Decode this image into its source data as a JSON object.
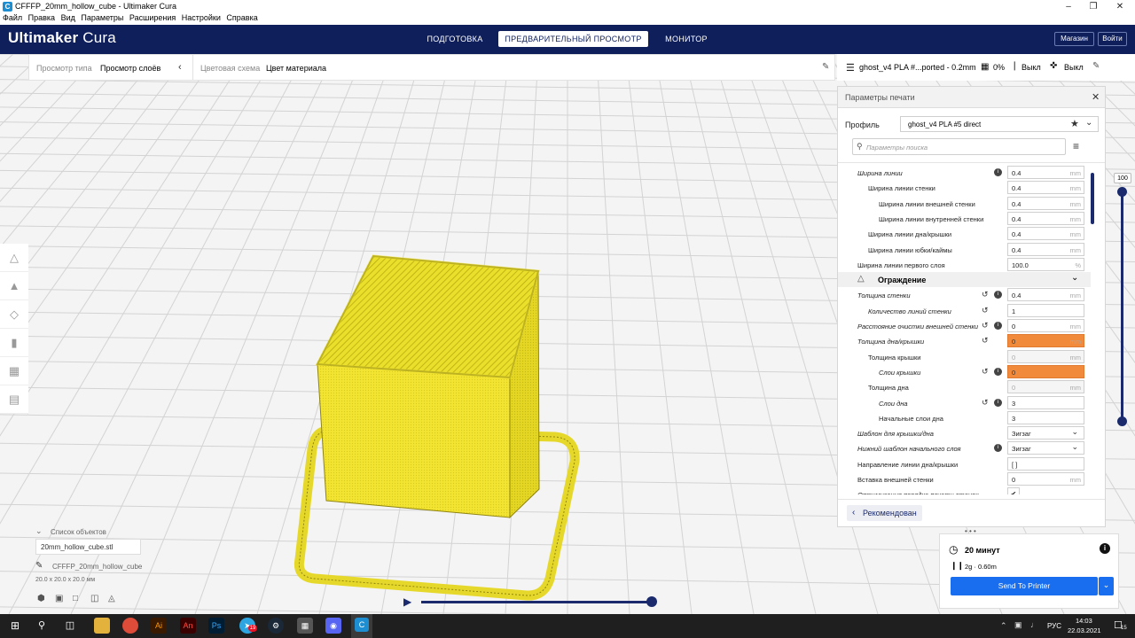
{
  "window": {
    "title": "CFFFP_20mm_hollow_cube - Ultimaker Cura"
  },
  "menu": [
    "Файл",
    "Правка",
    "Вид",
    "Параметры",
    "Расширения",
    "Настройки",
    "Справка"
  ],
  "header": {
    "logo_bold": "Ultimaker",
    "logo_light": "Cura",
    "stages": {
      "prepare": "ПОДГОТОВКА",
      "preview": "ПРЕДВАРИТЕЛЬНЫЙ ПРОСМОТР",
      "monitor": "МОНИТОР"
    },
    "marketplace": "Магазин",
    "signin": "Войти"
  },
  "viewbar": {
    "view_type_label": "Просмотр типа",
    "view_type_value": "Просмотр слоёв",
    "color_scheme_label": "Цветовая схема",
    "color_scheme_value": "Цвет материала"
  },
  "print_setup": {
    "profile_summary": "ghost_v4 PLA #...ported - 0.2mm",
    "infill": "0%",
    "support": "Выкл",
    "adhesion": "Выкл"
  },
  "panel": {
    "title": "Параметры печати",
    "profile_label": "Профиль",
    "profile_value": "ghost_v4 PLA #5 direct",
    "search_placeholder": "Параметры поиска",
    "recommended_button": "Рекомендован",
    "rows": [
      {
        "name": "Ширина линии",
        "value": "0.4",
        "unit": "mm"
      },
      {
        "name": "Ширина линии стенки",
        "value": "0.4",
        "unit": "mm"
      },
      {
        "name": "Ширина линии внешней стенки",
        "value": "0.4",
        "unit": "mm"
      },
      {
        "name": "Ширина линии внутренней стенки",
        "value": "0.4",
        "unit": "mm"
      },
      {
        "name": "Ширина линии дна/крышки",
        "value": "0.4",
        "unit": "mm"
      },
      {
        "name": "Ширина линии юбки/каймы",
        "value": "0.4",
        "unit": "mm"
      },
      {
        "name": "Ширина линии первого слоя",
        "value": "100.0",
        "unit": "%"
      },
      {
        "name": "Ограждение"
      },
      {
        "name": "Толщина стенки",
        "value": "0.4",
        "unit": "mm"
      },
      {
        "name": "Количество линий стенки",
        "value": "1",
        "unit": ""
      },
      {
        "name": "Расстояние очистки внешней стенки",
        "value": "0",
        "unit": "mm"
      },
      {
        "name": "Толщина дна/крышки",
        "value": "0",
        "unit": "mm"
      },
      {
        "name": "Толщина крышки",
        "value": "0",
        "unit": "mm"
      },
      {
        "name": "Слои крышки",
        "value": "0",
        "unit": ""
      },
      {
        "name": "Толщина дна",
        "value": "0",
        "unit": "mm"
      },
      {
        "name": "Слои дна",
        "value": "3",
        "unit": ""
      },
      {
        "name": "Начальные слои дна",
        "value": "3",
        "unit": ""
      },
      {
        "name": "Шаблон для крышки/дна",
        "value": "Зигзаг",
        "unit": ""
      },
      {
        "name": "Нижний шаблон начального слоя",
        "value": "Зигзаг",
        "unit": ""
      },
      {
        "name": "Направление линии дна/крышки",
        "value": "[ ]",
        "unit": ""
      },
      {
        "name": "Вставка внешней стенки",
        "value": "0",
        "unit": "mm"
      },
      {
        "name": "Оптимизация порядка печати стенок",
        "value": "✔",
        "unit": ""
      }
    ]
  },
  "layer_slider": {
    "value": "100",
    "position": 1.0
  },
  "objects": {
    "header": "Список объектов",
    "list_item": "20mm_hollow_cube.stl",
    "filename": "CFFFP_20mm_hollow_cube",
    "dimensions": "20.0 x 20.0 x 20.0 мм"
  },
  "estimate": {
    "time": "20 минут",
    "material": "2g · 0.60m",
    "send_button": "Send To Printer"
  },
  "taskbar": {
    "language": "РУС",
    "time": "14:03",
    "date": "22.03.2021",
    "notifications": "15"
  },
  "colors": {
    "header": "#0f1f5c",
    "accent": "#196ef0",
    "setting_error": "#f28a3b",
    "model": "#f2e431"
  }
}
